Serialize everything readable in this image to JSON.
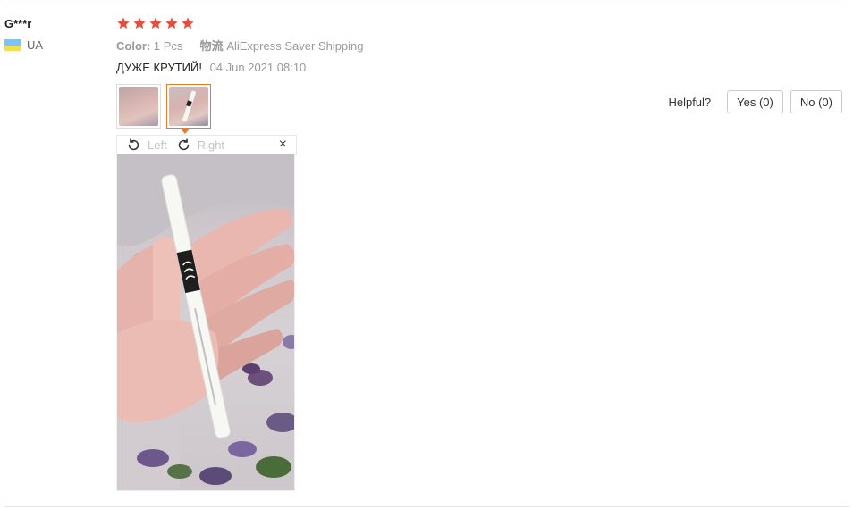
{
  "user": {
    "name": "G***r",
    "country": "UA"
  },
  "review": {
    "rating": 5,
    "rating_max": 5,
    "star_color": "#e74c3c",
    "color_label": "Color:",
    "color_value": "1 Pcs",
    "shipping_label": "物流",
    "shipping_value": "AliExpress Saver Shipping",
    "text": "ДУЖЕ КРУТИЙ!",
    "date": "04 Jun 2021 08:10"
  },
  "photos": {
    "count": 2,
    "selected_index": 1
  },
  "viewer": {
    "rotate_left": "Left",
    "rotate_right": "Right",
    "close": "×"
  },
  "helpful": {
    "label": "Helpful?",
    "yes": "Yes (0)",
    "no": "No (0)"
  },
  "colors": {
    "accent": "#e87a2a",
    "flag_top": "#7fc3f0",
    "flag_bottom": "#f5e04a"
  }
}
